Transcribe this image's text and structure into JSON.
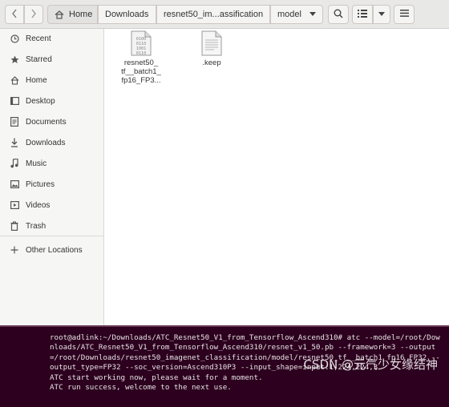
{
  "header": {
    "back_icon": "chevron-left-icon",
    "forward_icon": "chevron-right-icon",
    "breadcrumbs": [
      {
        "label": "Home",
        "icon": "home-icon"
      },
      {
        "label": "Downloads"
      },
      {
        "label": "resnet50_im...assification"
      },
      {
        "label": "model"
      }
    ],
    "search_icon": "search-icon",
    "view_icon": "list-view-icon",
    "menu_icon": "hamburger-menu-icon"
  },
  "sidebar": {
    "items": [
      {
        "label": "Recent",
        "icon": "clock-icon"
      },
      {
        "label": "Starred",
        "icon": "star-icon"
      },
      {
        "label": "Home",
        "icon": "home-icon"
      },
      {
        "label": "Desktop",
        "icon": "desktop-icon"
      },
      {
        "label": "Documents",
        "icon": "document-icon"
      },
      {
        "label": "Downloads",
        "icon": "download-icon"
      },
      {
        "label": "Music",
        "icon": "music-icon"
      },
      {
        "label": "Pictures",
        "icon": "picture-icon"
      },
      {
        "label": "Videos",
        "icon": "video-icon"
      },
      {
        "label": "Trash",
        "icon": "trash-icon"
      }
    ],
    "other_locations": {
      "label": "Other Locations",
      "icon": "plus-icon"
    }
  },
  "files": [
    {
      "name_lines": [
        "resnet50_",
        "tf__batch1_",
        "fp16_FP3..."
      ],
      "icon": "binary-file-icon"
    },
    {
      "name_lines": [
        ".keep"
      ],
      "icon": "text-file-icon"
    }
  ],
  "terminal": {
    "text": "root@adlink:~/Downloads/ATC_Resnet50_V1_from_Tensorflow_Ascend310# atc --model=/root/Downloads/ATC_Resnet50_V1_from_Tensorflow_Ascend310/resnet_v1_50.pb --framework=3 --output=/root/Downloads/resnet50_imagenet_classification/model/resnet50_tf__batch1_fp16_FP32 --output_type=FP32 --soc_version=Ascend310P3 --input_shape=input:1,224,224,3\nATC start working now, please wait for a moment.\nATC run success, welcome to the next use."
  },
  "watermark": "CSDN @元气少女缘结神"
}
